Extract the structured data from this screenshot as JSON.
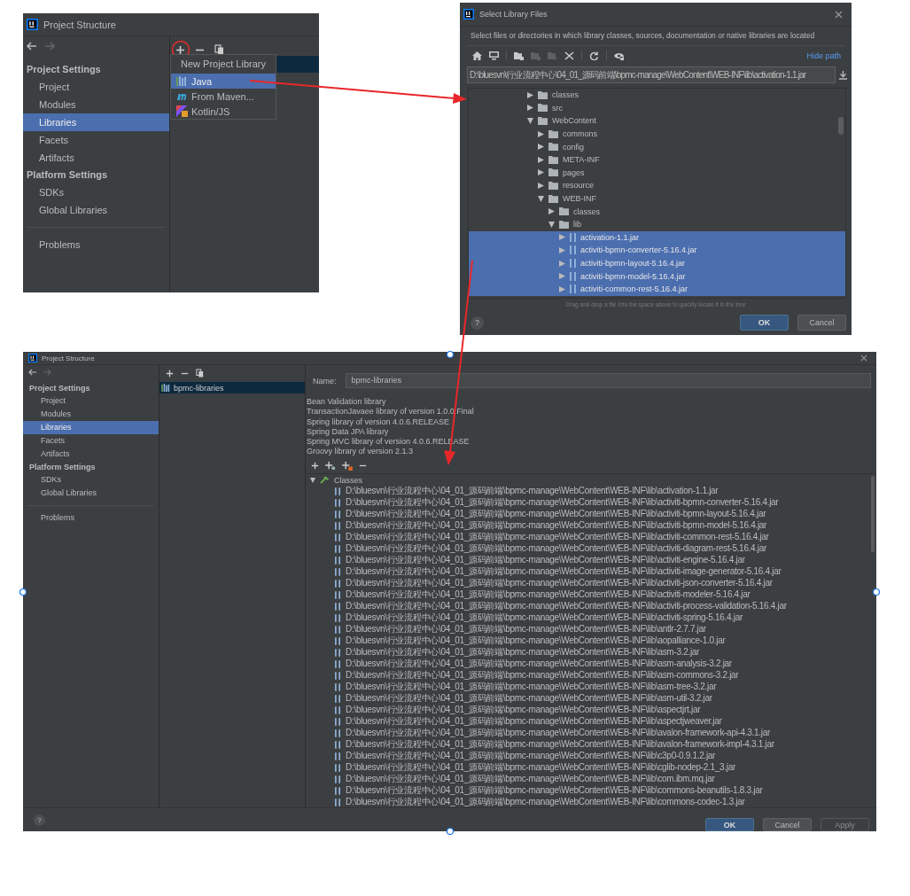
{
  "project_structure_menu": {
    "title": "Project Structure",
    "add_circled": true,
    "sidebar": {
      "sections": [
        {
          "heading": "Project Settings",
          "items": [
            {
              "label": "Project",
              "selected": false
            },
            {
              "label": "Modules",
              "selected": false
            },
            {
              "label": "Libraries",
              "selected": true
            },
            {
              "label": "Facets",
              "selected": false
            },
            {
              "label": "Artifacts",
              "selected": false
            }
          ]
        },
        {
          "heading": "Platform Settings",
          "items": [
            {
              "label": "SDKs",
              "selected": false
            },
            {
              "label": "Global Libraries",
              "selected": false
            }
          ]
        }
      ],
      "footer_items": [
        {
          "label": "Problems",
          "selected": false
        }
      ]
    },
    "popup": {
      "title": "New Project Library",
      "items": [
        {
          "label": "Java",
          "kind": "java",
          "selected": true
        },
        {
          "label": "From Maven...",
          "kind": "maven",
          "selected": false
        },
        {
          "label": "Kotlin/JS",
          "kind": "kotlin",
          "selected": false
        }
      ]
    }
  },
  "select_library_dialog": {
    "title": "Select Library Files",
    "description": "Select files or directories in which library classes, sources, documentation or native libraries are located",
    "toolbar": [
      {
        "kind": "home",
        "disabled": false
      },
      {
        "kind": "desktop",
        "disabled": false
      },
      {
        "kind": "folder",
        "disabled": false
      },
      {
        "kind": "folder",
        "disabled": true
      },
      {
        "kind": "new-folder",
        "disabled": true
      },
      {
        "kind": "delete",
        "disabled": false
      },
      {
        "kind": "refresh",
        "disabled": false
      },
      {
        "kind": "hidden",
        "disabled": false
      }
    ],
    "hide_path": "Hide path",
    "path": "D:\\bluesvn\\行业流程中心\\04_01_源码前端\\bpmc-manage\\WebContent\\WEB-INF\\lib\\activation-1.1.jar",
    "tree": [
      {
        "label": "classes",
        "kind": "folder",
        "expanded": false,
        "selected": false
      },
      {
        "label": "src",
        "kind": "folder",
        "expanded": false,
        "selected": false
      },
      {
        "label": "WebContent",
        "kind": "folder",
        "expanded": true,
        "selected": false,
        "children": [
          {
            "label": "commons",
            "kind": "folder",
            "expanded": false,
            "selected": false
          },
          {
            "label": "config",
            "kind": "folder",
            "expanded": false,
            "selected": false
          },
          {
            "label": "META-INF",
            "kind": "folder",
            "expanded": false,
            "selected": false
          },
          {
            "label": "pages",
            "kind": "folder",
            "expanded": false,
            "selected": false
          },
          {
            "label": "resource",
            "kind": "folder",
            "expanded": false,
            "selected": false
          },
          {
            "label": "WEB-INF",
            "kind": "folder",
            "expanded": true,
            "selected": false,
            "children": [
              {
                "label": "classes",
                "kind": "folder",
                "expanded": false,
                "selected": false
              },
              {
                "label": "lib",
                "kind": "folder",
                "expanded": true,
                "selected": false,
                "children": [
                  {
                    "label": "activation-1.1.jar",
                    "kind": "jar",
                    "expanded": false,
                    "selected": true
                  },
                  {
                    "label": "activiti-bpmn-converter-5.16.4.jar",
                    "kind": "jar",
                    "expanded": false,
                    "selected": true
                  },
                  {
                    "label": "activiti-bpmn-layout-5.16.4.jar",
                    "kind": "jar",
                    "expanded": false,
                    "selected": true
                  },
                  {
                    "label": "activiti-bpmn-model-5.16.4.jar",
                    "kind": "jar",
                    "expanded": false,
                    "selected": true
                  },
                  {
                    "label": "activiti-common-rest-5.16.4.jar",
                    "kind": "jar",
                    "expanded": false,
                    "selected": true
                  }
                ]
              }
            ]
          }
        ]
      }
    ],
    "hint": "Drag and drop a file into the space above to quickly locate it in the tree",
    "help": "?",
    "buttons": [
      {
        "label": "OK",
        "kind": "primary"
      },
      {
        "label": "Cancel",
        "kind": "normal"
      }
    ]
  },
  "project_structure_libraries": {
    "title": "Project Structure",
    "sidebar": {
      "sections": [
        {
          "heading": "Project Settings",
          "items": [
            {
              "label": "Project",
              "selected": false
            },
            {
              "label": "Modules",
              "selected": false
            },
            {
              "label": "Libraries",
              "selected": true
            },
            {
              "label": "Facets",
              "selected": false
            },
            {
              "label": "Artifacts",
              "selected": false
            }
          ]
        },
        {
          "heading": "Platform Settings",
          "items": [
            {
              "label": "SDKs",
              "selected": false
            },
            {
              "label": "Global Libraries",
              "selected": false
            }
          ]
        }
      ],
      "footer_items": [
        {
          "label": "Problems",
          "selected": false
        }
      ]
    },
    "libraries": [
      {
        "label": "bpmc-libraries",
        "selected": true
      }
    ],
    "name_label": "Name:",
    "name_value": "bpmc-libraries",
    "descriptions": [
      "Bean Validation library",
      "TransactionJavaee library of version 1.0.0.Final",
      "Spring library of version 4.0.6.RELEASE",
      "Spring Data JPA library",
      "Spring MVC library of version 4.0.6.RELEASE",
      "Groovy library of version 2.1.3"
    ],
    "classes": {
      "label": "Classes",
      "expanded": true,
      "items": [
        "D:\\bluesvn\\行业流程中心\\04_01_源码前端\\bpmc-manage\\WebContent\\WEB-INF\\lib\\activation-1.1.jar",
        "D:\\bluesvn\\行业流程中心\\04_01_源码前端\\bpmc-manage\\WebContent\\WEB-INF\\lib\\activiti-bpmn-converter-5.16.4.jar",
        "D:\\bluesvn\\行业流程中心\\04_01_源码前端\\bpmc-manage\\WebContent\\WEB-INF\\lib\\activiti-bpmn-layout-5.16.4.jar",
        "D:\\bluesvn\\行业流程中心\\04_01_源码前端\\bpmc-manage\\WebContent\\WEB-INF\\lib\\activiti-bpmn-model-5.16.4.jar",
        "D:\\bluesvn\\行业流程中心\\04_01_源码前端\\bpmc-manage\\WebContent\\WEB-INF\\lib\\activiti-common-rest-5.16.4.jar",
        "D:\\bluesvn\\行业流程中心\\04_01_源码前端\\bpmc-manage\\WebContent\\WEB-INF\\lib\\activiti-diagram-rest-5.16.4.jar",
        "D:\\bluesvn\\行业流程中心\\04_01_源码前端\\bpmc-manage\\WebContent\\WEB-INF\\lib\\activiti-engine-5.16.4.jar",
        "D:\\bluesvn\\行业流程中心\\04_01_源码前端\\bpmc-manage\\WebContent\\WEB-INF\\lib\\activiti-image-generator-5.16.4.jar",
        "D:\\bluesvn\\行业流程中心\\04_01_源码前端\\bpmc-manage\\WebContent\\WEB-INF\\lib\\activiti-json-converter-5.16.4.jar",
        "D:\\bluesvn\\行业流程中心\\04_01_源码前端\\bpmc-manage\\WebContent\\WEB-INF\\lib\\activiti-modeler-5.16.4.jar",
        "D:\\bluesvn\\行业流程中心\\04_01_源码前端\\bpmc-manage\\WebContent\\WEB-INF\\lib\\activiti-process-validation-5.16.4.jar",
        "D:\\bluesvn\\行业流程中心\\04_01_源码前端\\bpmc-manage\\WebContent\\WEB-INF\\lib\\activiti-spring-5.16.4.jar",
        "D:\\bluesvn\\行业流程中心\\04_01_源码前端\\bpmc-manage\\WebContent\\WEB-INF\\lib\\antlr-2.7.7.jar",
        "D:\\bluesvn\\行业流程中心\\04_01_源码前端\\bpmc-manage\\WebContent\\WEB-INF\\lib\\aopalliance-1.0.jar",
        "D:\\bluesvn\\行业流程中心\\04_01_源码前端\\bpmc-manage\\WebContent\\WEB-INF\\lib\\asm-3.2.jar",
        "D:\\bluesvn\\行业流程中心\\04_01_源码前端\\bpmc-manage\\WebContent\\WEB-INF\\lib\\asm-analysis-3.2.jar",
        "D:\\bluesvn\\行业流程中心\\04_01_源码前端\\bpmc-manage\\WebContent\\WEB-INF\\lib\\asm-commons-3.2.jar",
        "D:\\bluesvn\\行业流程中心\\04_01_源码前端\\bpmc-manage\\WebContent\\WEB-INF\\lib\\asm-tree-3.2.jar",
        "D:\\bluesvn\\行业流程中心\\04_01_源码前端\\bpmc-manage\\WebContent\\WEB-INF\\lib\\asm-util-3.2.jar",
        "D:\\bluesvn\\行业流程中心\\04_01_源码前端\\bpmc-manage\\WebContent\\WEB-INF\\lib\\aspectjrt.jar",
        "D:\\bluesvn\\行业流程中心\\04_01_源码前端\\bpmc-manage\\WebContent\\WEB-INF\\lib\\aspectjweaver.jar",
        "D:\\bluesvn\\行业流程中心\\04_01_源码前端\\bpmc-manage\\WebContent\\WEB-INF\\lib\\avalon-framework-api-4.3.1.jar",
        "D:\\bluesvn\\行业流程中心\\04_01_源码前端\\bpmc-manage\\WebContent\\WEB-INF\\lib\\avalon-framework-impl-4.3.1.jar",
        "D:\\bluesvn\\行业流程中心\\04_01_源码前端\\bpmc-manage\\WebContent\\WEB-INF\\lib\\c3p0-0.9.1.2.jar",
        "D:\\bluesvn\\行业流程中心\\04_01_源码前端\\bpmc-manage\\WebContent\\WEB-INF\\lib\\cglib-nodep-2.1_3.jar",
        "D:\\bluesvn\\行业流程中心\\04_01_源码前端\\bpmc-manage\\WebContent\\WEB-INF\\lib\\com.ibm.mq.jar",
        "D:\\bluesvn\\行业流程中心\\04_01_源码前端\\bpmc-manage\\WebContent\\WEB-INF\\lib\\commons-beanutils-1.8.3.jar",
        "D:\\bluesvn\\行业流程中心\\04_01_源码前端\\bpmc-manage\\WebContent\\WEB-INF\\lib\\commons-codec-1.3.jar"
      ]
    },
    "help": "?",
    "buttons": [
      {
        "label": "OK",
        "kind": "primary",
        "disabled": false
      },
      {
        "label": "Cancel",
        "kind": "normal",
        "disabled": false
      },
      {
        "label": "Apply",
        "kind": "normal",
        "disabled": true
      }
    ]
  }
}
